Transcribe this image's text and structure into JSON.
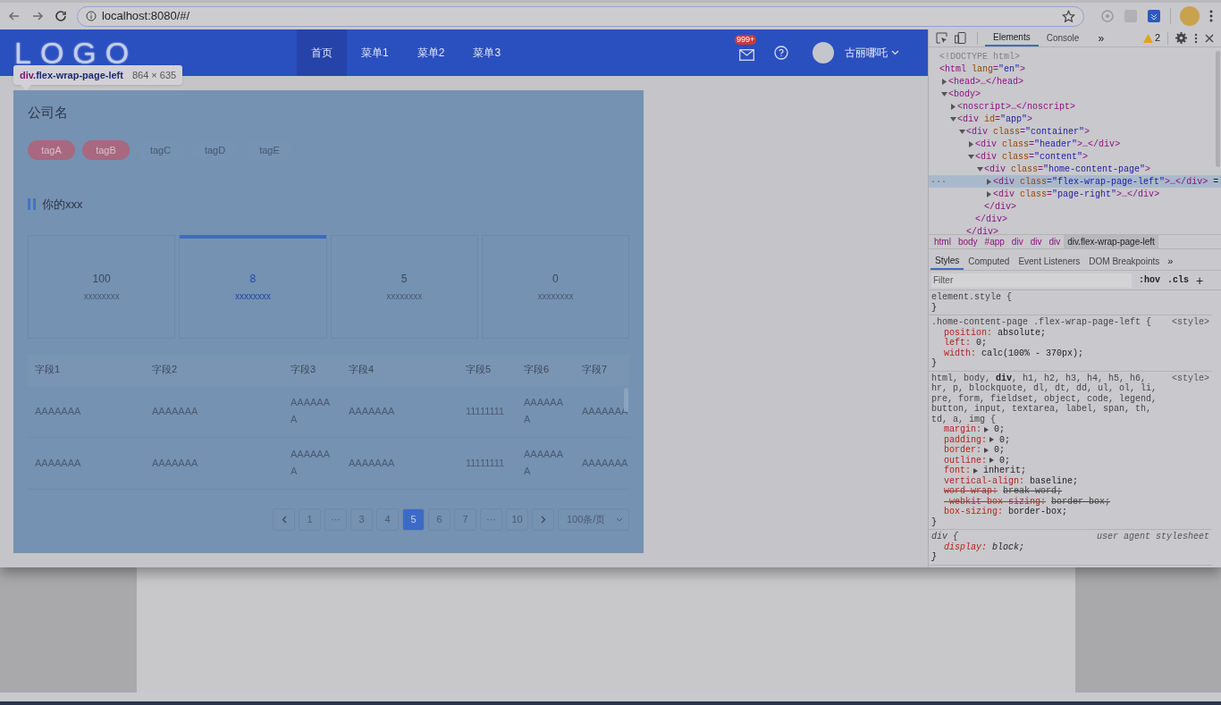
{
  "browser": {
    "url": "localhost:8080/#/"
  },
  "header": {
    "logo": "LOGO",
    "nav": [
      {
        "label": "首页",
        "selected": true
      },
      {
        "label": "菜单1",
        "selected": false
      },
      {
        "label": "菜单2",
        "selected": false
      },
      {
        "label": "菜单3",
        "selected": false
      }
    ],
    "badge": "999+",
    "user": "古丽哪吒"
  },
  "inspect_tooltip": {
    "tag": "div",
    "selector": ".flex-wrap-page-left",
    "size": "864 × 635"
  },
  "page": {
    "company": "公司名",
    "tags": [
      {
        "label": "tagA",
        "selected": true
      },
      {
        "label": "tagB",
        "selected": true
      },
      {
        "label": "tagC",
        "selected": false
      },
      {
        "label": "tagD",
        "selected": false
      },
      {
        "label": "tagE",
        "selected": false
      }
    ],
    "section_title": "你的xxx",
    "stats": [
      {
        "value": "100",
        "label": "xxxxxxxx",
        "selected": false
      },
      {
        "value": "8",
        "label": "xxxxxxxx",
        "selected": true
      },
      {
        "value": "5",
        "label": "xxxxxxxx",
        "selected": false
      },
      {
        "value": "0",
        "label": "xxxxxxxx",
        "selected": false
      }
    ],
    "table": {
      "columns": [
        "字段1",
        "字段2",
        "字段3",
        "字段4",
        "字段5",
        "字段6",
        "字段7"
      ],
      "rows": [
        [
          "AAAAAAA",
          "AAAAAAA",
          "AAAAAAA",
          "AAAAAAA",
          "11111111",
          "AAAAAAA",
          "AAAAAAA"
        ],
        [
          "AAAAAAA",
          "AAAAAAA",
          "AAAAAAA",
          "AAAAAAA",
          "11111111",
          "AAAAAAA",
          "AAAAAAA"
        ]
      ]
    },
    "pagination": {
      "items": [
        {
          "kind": "prev"
        },
        {
          "kind": "page",
          "label": "1",
          "selected": false
        },
        {
          "kind": "ellipsis",
          "label": "···"
        },
        {
          "kind": "page",
          "label": "3",
          "selected": false
        },
        {
          "kind": "page",
          "label": "4",
          "selected": false
        },
        {
          "kind": "page",
          "label": "5",
          "selected": true
        },
        {
          "kind": "page",
          "label": "6",
          "selected": false
        },
        {
          "kind": "page",
          "label": "7",
          "selected": false
        },
        {
          "kind": "ellipsis",
          "label": "···"
        },
        {
          "kind": "page",
          "label": "10",
          "selected": false
        },
        {
          "kind": "next"
        }
      ],
      "page_size": "100条/页"
    }
  },
  "devtools": {
    "tabs": [
      {
        "label": "Elements",
        "selected": true
      },
      {
        "label": "Console",
        "selected": false
      }
    ],
    "more": "»",
    "warnings": "2",
    "dom": [
      {
        "text": "<!DOCTYPE html>",
        "kind": "doctype"
      },
      {
        "text": "<html lang=\"en\">",
        "kind": "root",
        "children": [
          {
            "text": "<head>…</head>",
            "kind": "element",
            "expanded": false
          },
          {
            "text": "<body>",
            "kind": "element",
            "expanded": true,
            "children": [
              {
                "text": "<noscript>…</noscript>",
                "kind": "element",
                "expanded": false
              },
              {
                "text": "<div id=\"app\">",
                "kind": "element",
                "expanded": true,
                "children": [
                  {
                    "text": "<div class=\"container\">",
                    "kind": "element",
                    "expanded": true,
                    "close": "</div>",
                    "children": [
                      {
                        "text": "<div class=\"header\">…</div>",
                        "kind": "element",
                        "expanded": false
                      },
                      {
                        "text": "<div class=\"content\">",
                        "kind": "element",
                        "expanded": true,
                        "close": "</div>",
                        "children": [
                          {
                            "text": "<div class=\"home-content-page\">",
                            "kind": "element",
                            "expanded": true,
                            "close": "</div>",
                            "children": [
                              {
                                "text": "<div class=\"flex-wrap-page-left\">…</div>",
                                "kind": "element",
                                "expanded": false,
                                "selected": true,
                                "suffix": "=",
                                "dots": "···"
                              },
                              {
                                "text": "<div class=\"page-right\">…</div>",
                                "kind": "element",
                                "expanded": false,
                                "selected": false
                              }
                            ]
                          }
                        ]
                      }
                    ]
                  }
                ]
              }
            ]
          }
        ]
      }
    ],
    "breadcrumb": [
      {
        "label": "html",
        "selected": false
      },
      {
        "label": "body",
        "selected": false
      },
      {
        "label": "#app",
        "selected": false
      },
      {
        "label": "div",
        "selected": false
      },
      {
        "label": "div",
        "selected": false
      },
      {
        "label": "div",
        "selected": false
      },
      {
        "label": "div.flex-wrap-page-left",
        "selected": true
      }
    ],
    "style_tabs": [
      {
        "label": "Styles",
        "selected": true
      },
      {
        "label": "Computed",
        "selected": false
      },
      {
        "label": "Event Listeners",
        "selected": false
      },
      {
        "label": "DOM Breakpoints",
        "selected": false
      }
    ],
    "style_more": "»",
    "filter": {
      "placeholder": "Filter"
    },
    "hov": ":hov",
    "cls": ".cls",
    "add": "+",
    "rules": [
      {
        "selector": "element.style {",
        "close": "}",
        "user_agent": false
      },
      {
        "selector": ".home-content-page .flex-wrap-page-left {",
        "source": "<style>",
        "close": "}",
        "user_agent": false,
        "declarations": [
          {
            "prop": "position:",
            "value": "absolute;"
          },
          {
            "prop": "left:",
            "value": "0;"
          },
          {
            "prop": "width:",
            "value": "calc(100% - 370px);"
          }
        ]
      },
      {
        "selector": "html, body, **div**, h1, h2, h3, h4, h5, h6, hr, p, blockquote, dl, dt, dd, ul, ol, li, pre, form, fieldset, object, code, legend, button, input, textarea, label, span, th, td, a, img {",
        "source": "<style>",
        "close": "}",
        "user_agent": false,
        "declarations": [
          {
            "prop": "margin:",
            "value": "0;",
            "expandable": true
          },
          {
            "prop": "padding:",
            "value": "0;",
            "expandable": true
          },
          {
            "prop": "border:",
            "value": "0;",
            "expandable": true
          },
          {
            "prop": "outline:",
            "value": "0;",
            "expandable": true
          },
          {
            "prop": "font:",
            "value": "inherit;",
            "expandable": true
          },
          {
            "prop": "vertical-align:",
            "value": "baseline;"
          },
          {
            "prop": "word-wrap:",
            "value": "break-word;",
            "struck": true
          },
          {
            "prop": "-webkit-box-sizing:",
            "value": "border-box;",
            "struck": true
          },
          {
            "prop": "box-sizing:",
            "value": "border-box;"
          }
        ]
      },
      {
        "selector": "div {",
        "source": "user agent stylesheet",
        "close": "}",
        "user_agent": true,
        "declarations": [
          {
            "prop": "display:",
            "value": "block;"
          }
        ]
      }
    ]
  }
}
